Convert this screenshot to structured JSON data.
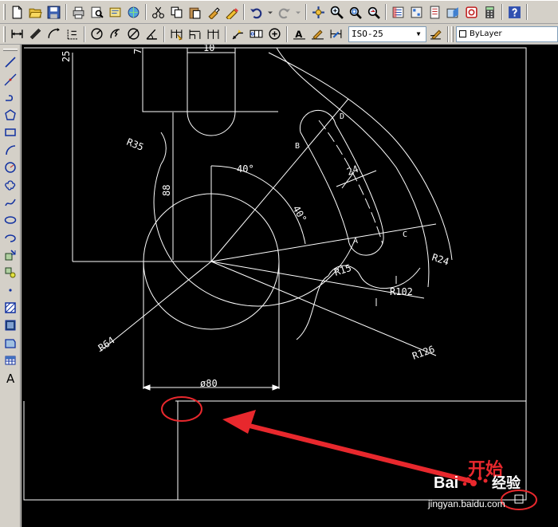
{
  "toolbar": {
    "dimstyle": "ISO-25",
    "layer": "ByLayer"
  },
  "drawing": {
    "labels": {
      "r35": "R35",
      "r64": "R64",
      "r24": "R24",
      "r15": "R15",
      "r102": "R102",
      "r126": "R126",
      "d80": "ø80",
      "d88": "88",
      "w24": "24",
      "a40a": "40°",
      "a40b": "40°",
      "d25": "25",
      "d7": "7",
      "d10": "10",
      "pa": "A",
      "pb": "B",
      "pc": "C",
      "pd": "D"
    }
  },
  "watermark": {
    "kaishi": "开始",
    "baidu": "Bai",
    "jingyan": "经验",
    "url": "jingyan.baidu.com"
  },
  "colors": {
    "canvas": "#000000",
    "lines": "#ffffff",
    "annotation": "#e8282d",
    "toolbar": "#d4d0c8"
  }
}
